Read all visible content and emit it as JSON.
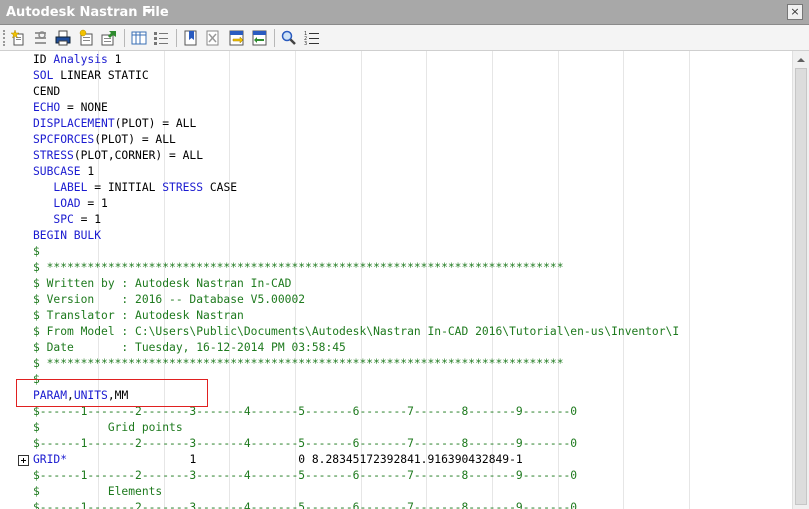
{
  "window": {
    "title": "Autodesk Nastran File",
    "close_glyph": "×"
  },
  "toolbar": {
    "buttons": [
      {
        "icon": "new-file-icon"
      },
      {
        "icon": "options-icon"
      },
      {
        "icon": "print-icon"
      },
      {
        "icon": "import-icon"
      },
      {
        "icon": "export-icon"
      },
      {
        "icon": "columns-icon"
      },
      {
        "icon": "list-view-icon"
      },
      {
        "icon": "bookmark-icon"
      },
      {
        "icon": "clear-icon"
      },
      {
        "icon": "goto-previous-icon"
      },
      {
        "icon": "goto-next-icon"
      },
      {
        "icon": "search-icon"
      },
      {
        "icon": "numbered-list-icon"
      }
    ]
  },
  "colors": {
    "keyword": "#1a1ad0",
    "comment": "#1e7a1e",
    "highlight_box": "#e02020"
  },
  "editor": {
    "lines": [
      [
        {
          "t": "ID "
        },
        {
          "t": "Analysis",
          "c": "kw"
        },
        {
          "t": " 1"
        }
      ],
      [
        {
          "t": "SOL",
          "c": "kw"
        },
        {
          "t": " LINEAR STATIC"
        }
      ],
      [
        {
          "t": "CEND"
        }
      ],
      [
        {
          "t": "ECHO",
          "c": "kw"
        },
        {
          "t": " = NONE"
        }
      ],
      [
        {
          "t": "DISPLACEMENT",
          "c": "kw"
        },
        {
          "t": "(PLOT) = ALL"
        }
      ],
      [
        {
          "t": "SPCFORCES",
          "c": "kw"
        },
        {
          "t": "(PLOT) = ALL"
        }
      ],
      [
        {
          "t": "STRESS",
          "c": "kw"
        },
        {
          "t": "(PLOT,CORNER) = ALL"
        }
      ],
      [
        {
          "t": "SUBCASE",
          "c": "kw"
        },
        {
          "t": " 1"
        }
      ],
      [
        {
          "t": "   "
        },
        {
          "t": "LABEL",
          "c": "kw"
        },
        {
          "t": " = INITIAL "
        },
        {
          "t": "STRESS",
          "c": "kw"
        },
        {
          "t": " CASE"
        }
      ],
      [
        {
          "t": "   "
        },
        {
          "t": "LOAD",
          "c": "kw"
        },
        {
          "t": " = 1"
        }
      ],
      [
        {
          "t": "   "
        },
        {
          "t": "SPC",
          "c": "kw"
        },
        {
          "t": " = 1"
        }
      ],
      [
        {
          "t": "BEGIN BULK",
          "c": "kw"
        }
      ],
      [
        {
          "t": "$",
          "c": "cm"
        }
      ],
      [
        {
          "t": "$ ****************************************************************************",
          "c": "cm"
        }
      ],
      [
        {
          "t": "$ Written by : Autodesk Nastran In-CAD",
          "c": "cm"
        }
      ],
      [
        {
          "t": "$ Version    : 2016 -- Database V5.00002",
          "c": "cm"
        }
      ],
      [
        {
          "t": "$ Translator : Autodesk Nastran",
          "c": "cm"
        }
      ],
      [
        {
          "t": "$ From Model : C:\\Users\\Public\\Documents\\Autodesk\\Nastran In-CAD 2016\\Tutorial\\en-us\\Inventor\\I",
          "c": "cm"
        }
      ],
      [
        {
          "t": "$ Date       : Tuesday, 16-12-2014 PM 03:58:45",
          "c": "cm"
        }
      ],
      [
        {
          "t": "$ ****************************************************************************",
          "c": "cm"
        }
      ],
      [
        {
          "t": "$",
          "c": "cm"
        }
      ],
      [
        {
          "t": "PARAM",
          "c": "kw"
        },
        {
          "t": ","
        },
        {
          "t": "UNITS",
          "c": "kw"
        },
        {
          "t": ",MM"
        }
      ],
      [
        {
          "t": "$------1-------2-------3-------4-------5-------6-------7-------8-------9-------0",
          "c": "cm"
        }
      ],
      [
        {
          "t": "$          Grid points",
          "c": "cm"
        }
      ],
      [
        {
          "t": "$------1-------2-------3-------4-------5-------6-------7-------8-------9-------0",
          "c": "cm"
        }
      ],
      [
        {
          "t": "GRID*",
          "c": "kw"
        },
        {
          "t": "                  1               0 8.28345172392841.916390432849-1"
        }
      ],
      [
        {
          "t": "$------1-------2-------3-------4-------5-------6-------7-------8-------9-------0",
          "c": "cm"
        }
      ],
      [
        {
          "t": "$          Elements",
          "c": "cm"
        }
      ],
      [
        {
          "t": "$------1-------2-------3-------4-------5-------6-------7-------8-------9-------0",
          "c": "cm"
        }
      ]
    ]
  }
}
